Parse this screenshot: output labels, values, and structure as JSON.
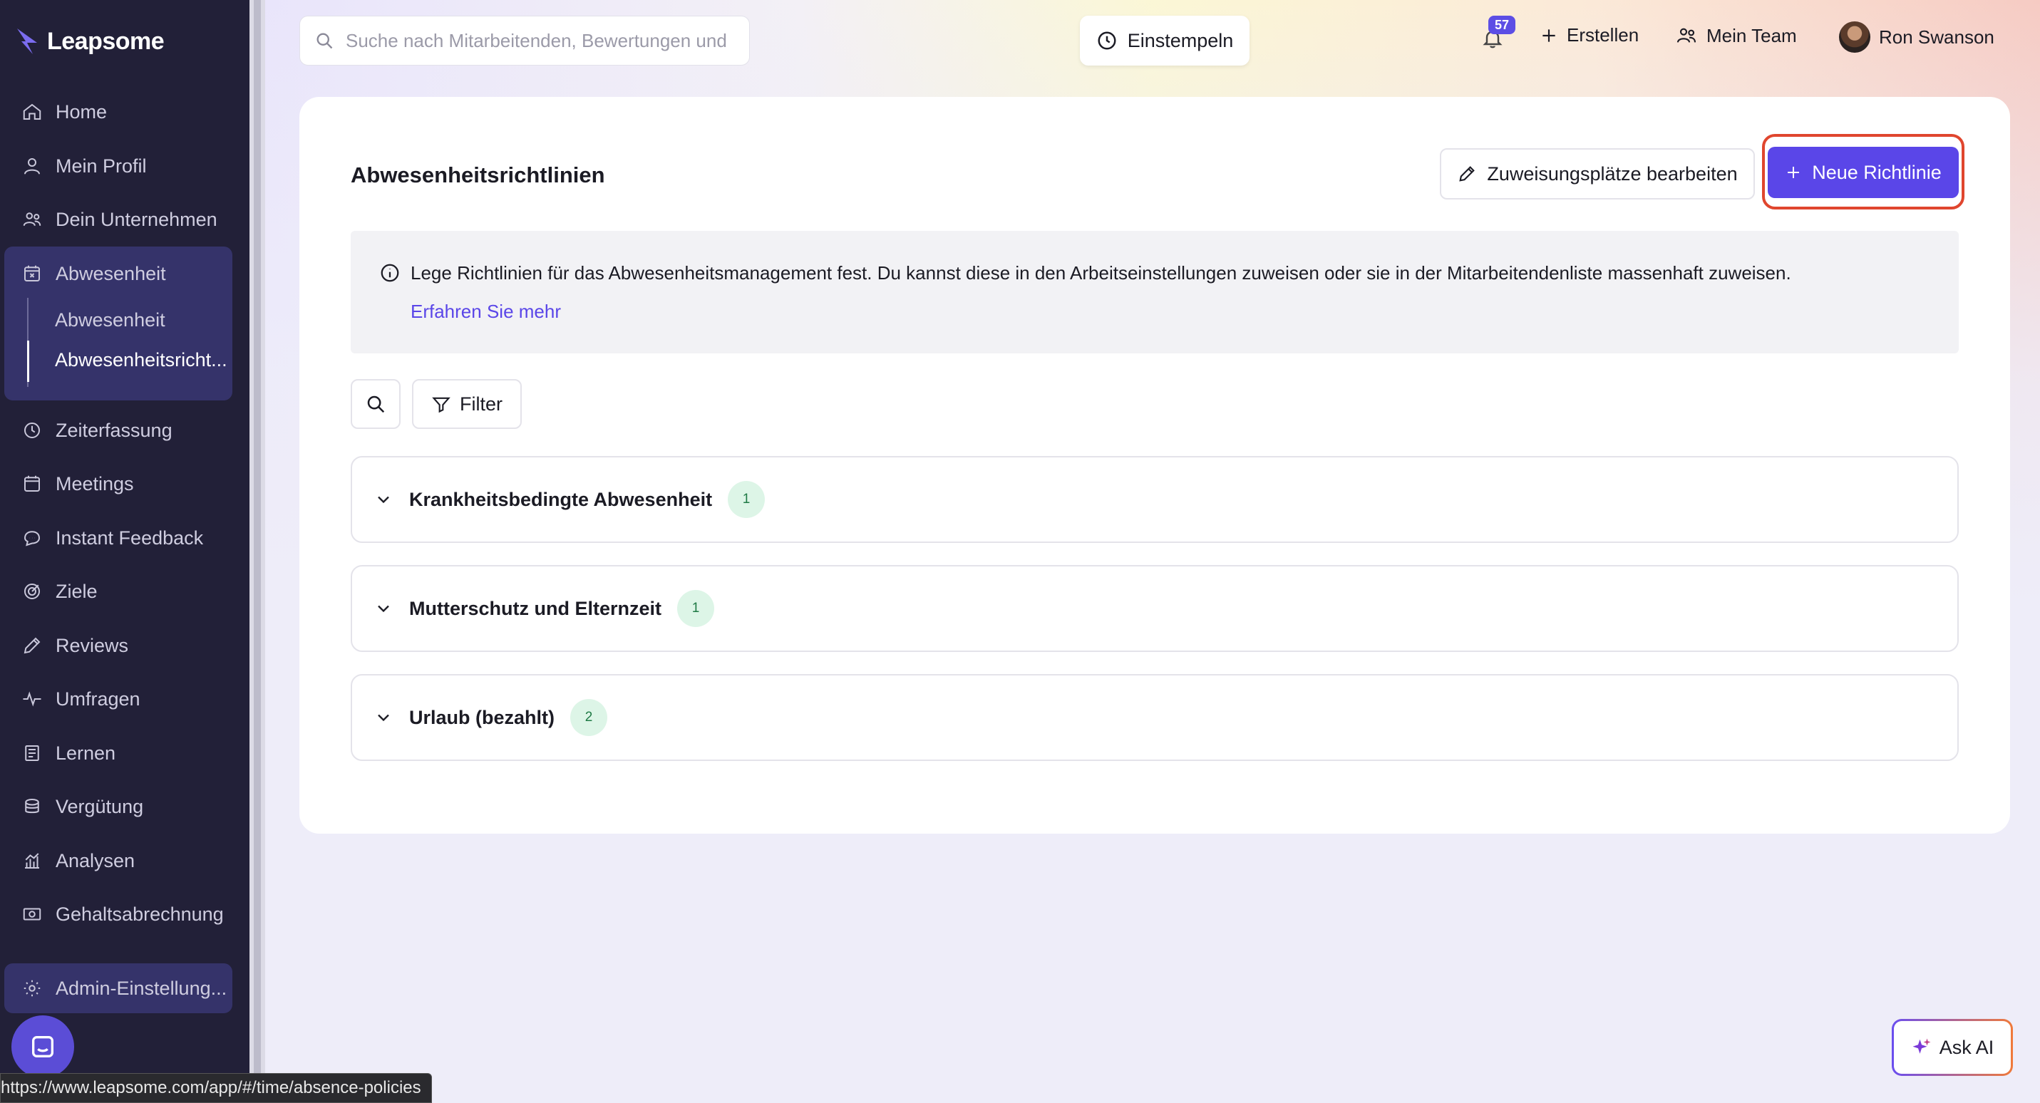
{
  "app": {
    "logo_text": "Leapsome"
  },
  "sidebar": {
    "items": [
      {
        "label": "Home",
        "icon": "home-icon"
      },
      {
        "label": "Mein Profil",
        "icon": "user-icon"
      },
      {
        "label": "Dein Unternehmen",
        "icon": "people-icon"
      },
      {
        "label": "Abwesenheit",
        "icon": "calendar-x-icon"
      },
      {
        "label": "Zeiterfassung",
        "icon": "clock-icon"
      },
      {
        "label": "Meetings",
        "icon": "calendar-icon"
      },
      {
        "label": "Instant Feedback",
        "icon": "chat-icon"
      },
      {
        "label": "Ziele",
        "icon": "target-icon"
      },
      {
        "label": "Reviews",
        "icon": "pen-icon"
      },
      {
        "label": "Umfragen",
        "icon": "pulse-icon"
      },
      {
        "label": "Lernen",
        "icon": "book-icon"
      },
      {
        "label": "Vergütung",
        "icon": "coins-icon"
      },
      {
        "label": "Analysen",
        "icon": "chart-icon"
      },
      {
        "label": "Gehaltsabrechnung",
        "icon": "money-icon"
      }
    ],
    "sub_items": [
      {
        "label": "Abwesenheit",
        "active": false
      },
      {
        "label": "Abwesenheitsricht...",
        "active": true
      }
    ],
    "admin_label": "Admin-Einstellung..."
  },
  "topbar": {
    "search_placeholder": "Suche nach Mitarbeitenden, Bewertungen und mehr",
    "clock_in_label": "Einstempeln",
    "notification_count": "57",
    "create_label": "Erstellen",
    "team_label": "Mein Team",
    "user_name": "Ron Swanson"
  },
  "page": {
    "title": "Abwesenheitsrichtlinien",
    "edit_button": "Zuweisungsplätze bearbeiten",
    "new_button": "Neue Richtlinie",
    "info_text": "Lege Richtlinien für das Abwesenheitsmanagement fest. Du kannst diese in den Arbeitseinstellungen zuweisen oder sie in der Mitarbeitendenliste massenhaft zuweisen.",
    "info_link": "Erfahren Sie mehr",
    "filter_label": "Filter",
    "groups": [
      {
        "name": "Krankheitsbedingte Abwesenheit",
        "count": "1"
      },
      {
        "name": "Mutterschutz und Elternzeit",
        "count": "1"
      },
      {
        "name": "Urlaub (bezahlt)",
        "count": "2"
      }
    ]
  },
  "ask_ai_label": "Ask AI",
  "status_url": "https://www.leapsome.com/app/#/time/absence-policies",
  "colors": {
    "accent": "#5a46e8",
    "sidebar_bg": "#222038",
    "highlight_outline": "#e0462e"
  }
}
